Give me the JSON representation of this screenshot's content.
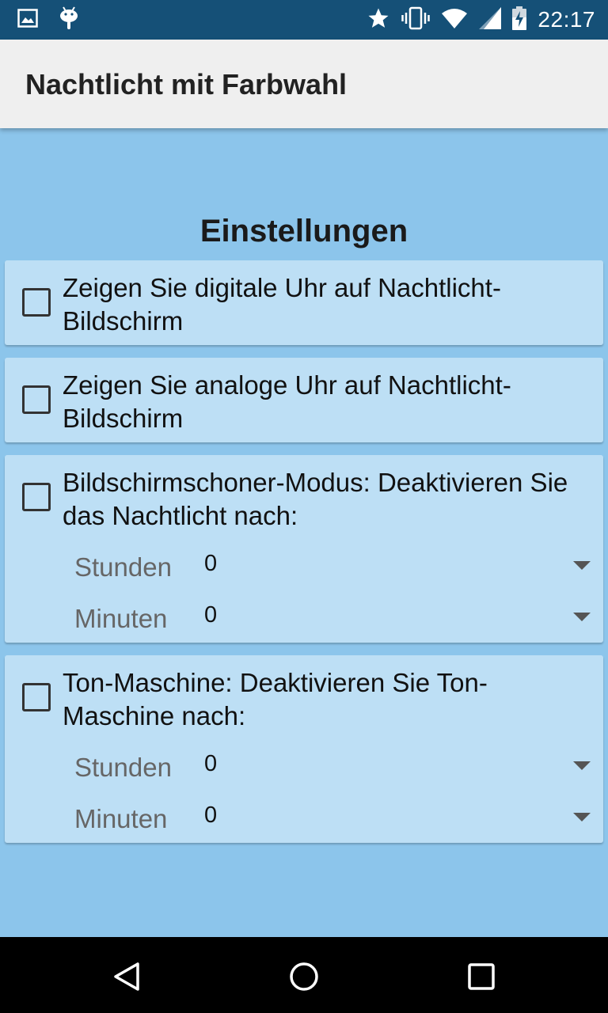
{
  "status_bar": {
    "time": "22:17",
    "left_icons": [
      "image-icon",
      "android-icon"
    ],
    "right_icons": [
      "star-icon",
      "vibrate-icon",
      "wifi-icon",
      "signal-icon",
      "battery-charging-icon"
    ]
  },
  "app_bar": {
    "title": "Nachtlicht mit Farbwahl"
  },
  "main": {
    "heading": "Einstellungen",
    "cards": [
      {
        "label": "Zeigen Sie digitale Uhr auf Nachtlicht-Bildschirm",
        "checked": false
      },
      {
        "label": "Zeigen Sie analoge Uhr auf Nachtlicht-Bildschirm",
        "checked": false
      },
      {
        "label": "Bildschirmschoner-Modus: Deaktivieren Sie das Nachtlicht nach:",
        "checked": false,
        "hours_label": "Stunden",
        "hours_value": "0",
        "minutes_label": "Minuten",
        "minutes_value": "0"
      },
      {
        "label": "Ton-Maschine: Deaktivieren Sie Ton-Maschine nach:",
        "checked": false,
        "hours_label": "Stunden",
        "hours_value": "0",
        "minutes_label": "Minuten",
        "minutes_value": "0"
      }
    ]
  },
  "colors": {
    "status_bar": "#155077",
    "app_bar": "#EFEFEF",
    "background": "#8CC5EB",
    "card": "#BDDFF5",
    "nav_bar": "#000000"
  },
  "nav_bar": {
    "icons": [
      "back-icon",
      "home-icon",
      "recents-icon"
    ]
  }
}
